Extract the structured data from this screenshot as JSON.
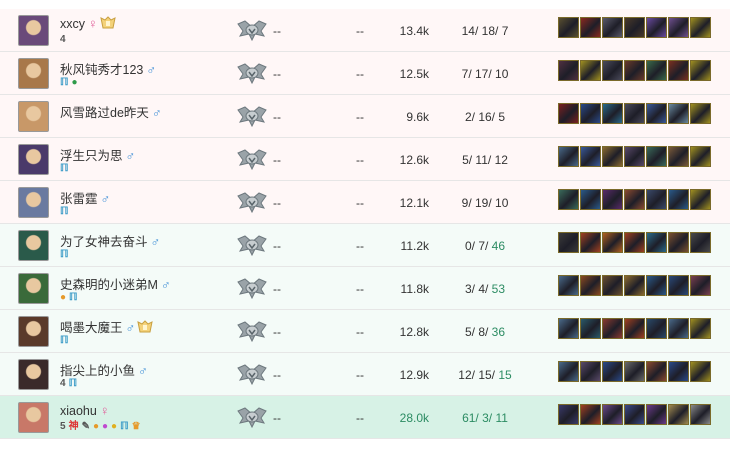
{
  "players": [
    {
      "name": "xxcy",
      "gender": "♀",
      "gender_class": "f",
      "honor": true,
      "tags": [
        {
          "t": "4",
          "c": "dark"
        }
      ],
      "avatar": "#6a4a7a",
      "damage": "13.4k",
      "k": "14",
      "d": "18",
      "a": "7",
      "result": "lose",
      "items": [
        "#5a5030",
        "#8a2a20",
        "#5a5a6a",
        "#4a3a2a",
        "#6a4aa0",
        "#705090",
        "#a09020"
      ]
    },
    {
      "name": "秋风钝秀才123",
      "gender": "♂",
      "gender_class": "m",
      "honor": false,
      "tags": [
        {
          "t": "ℿ",
          "c": "blue"
        },
        {
          "t": "●",
          "c": "green"
        }
      ],
      "avatar": "#a8784a",
      "damage": "12.5k",
      "k": "7",
      "d": "17",
      "a": "10",
      "result": "lose",
      "items": [
        "#503040",
        "#a09020",
        "#4a4a5a",
        "#6a3a2a",
        "#3a6a4a",
        "#7a3020",
        "#a09020"
      ]
    },
    {
      "name": "风雪路过de昨天",
      "gender": "♂",
      "gender_class": "m",
      "honor": false,
      "tags": [],
      "avatar": "#c89868",
      "damage": "9.6k",
      "k": "2",
      "d": "16",
      "a": "5",
      "result": "lose",
      "items": [
        "#7a2020",
        "#2a4a8a",
        "#2a6a8a",
        "#4a4a5a",
        "#3a5a9a",
        "#6a8aa0",
        "#a09020"
      ]
    },
    {
      "name": "浮生只为思",
      "gender": "♂",
      "gender_class": "m",
      "honor": false,
      "tags": [
        {
          "t": "ℿ",
          "c": "blue"
        }
      ],
      "avatar": "#4a3a6a",
      "damage": "12.6k",
      "k": "5",
      "d": "11",
      "a": "12",
      "result": "lose",
      "items": [
        "#4a6a8a",
        "#3a5a9a",
        "#8a6a30",
        "#5a4a6a",
        "#3a6a5a",
        "#7a5a3a",
        "#a09020"
      ]
    },
    {
      "name": "张雷霆",
      "gender": "♂",
      "gender_class": "m",
      "honor": false,
      "tags": [
        {
          "t": "ℿ",
          "c": "blue"
        }
      ],
      "avatar": "#6a7aa0",
      "damage": "12.1k",
      "k": "9",
      "d": "19",
      "a": "10",
      "result": "lose",
      "items": [
        "#3a6a5a",
        "#2a5a8a",
        "#5a2a6a",
        "#8a4a30",
        "#3a4a6a",
        "#2a5a8a",
        "#a09020"
      ]
    },
    {
      "name": "为了女神去奋斗",
      "gender": "♂",
      "gender_class": "m",
      "honor": false,
      "tags": [
        {
          "t": "ℿ",
          "c": "blue"
        }
      ],
      "avatar": "#2a5a4a",
      "damage": "11.2k",
      "k": "0",
      "d": "7",
      "a": "46",
      "result": "win",
      "items": [
        "#3a3a3a",
        "#a04020",
        "#b06020",
        "#a04020",
        "#2a6a8a",
        "#7a5030",
        "#4a4a4a"
      ]
    },
    {
      "name": "史森明的小迷弟M",
      "gender": "♂",
      "gender_class": "m",
      "honor": false,
      "tags": [
        {
          "t": "●",
          "c": "orange"
        },
        {
          "t": "ℿ",
          "c": "blue"
        }
      ],
      "avatar": "#3a6a3a",
      "damage": "11.8k",
      "k": "3",
      "d": "4",
      "a": "53",
      "result": "win",
      "items": [
        "#4a6a8a",
        "#8a4a20",
        "#6a5030",
        "#8a6a30",
        "#2a5a8a",
        "#2a4a7a",
        "#7a4050"
      ]
    },
    {
      "name": "喝墨大魔王",
      "gender": "♂",
      "gender_class": "m",
      "honor": true,
      "tags": [
        {
          "t": "ℿ",
          "c": "blue"
        }
      ],
      "avatar": "#5a3a2a",
      "damage": "12.8k",
      "k": "5",
      "d": "8",
      "a": "36",
      "result": "win",
      "items": [
        "#4a6a8a",
        "#2a5a6a",
        "#8a3a30",
        "#a04020",
        "#2a4a6a",
        "#4a6a8a",
        "#a09020"
      ]
    },
    {
      "name": "指尖上的小鱼",
      "gender": "♂",
      "gender_class": "m",
      "honor": false,
      "tags": [
        {
          "t": "4",
          "c": "dark"
        },
        {
          "t": "ℿ",
          "c": "blue"
        }
      ],
      "avatar": "#3a2a2a",
      "damage": "12.9k",
      "k": "12",
      "d": "15",
      "a": "15",
      "result": "win",
      "items": [
        "#4a6a8a",
        "#5a4a6a",
        "#2a4a8a",
        "#6a6a6a",
        "#8a4a30",
        "#2a4a8a",
        "#a09020"
      ]
    },
    {
      "name": "xiaohu",
      "gender": "♀",
      "gender_class": "f",
      "honor": false,
      "tags": [
        {
          "t": "5",
          "c": "dark"
        },
        {
          "t": "神",
          "c": "red"
        },
        {
          "t": "✎",
          "c": "dark"
        },
        {
          "t": "●",
          "c": "orange"
        },
        {
          "t": "●",
          "c": "purple"
        },
        {
          "t": "●",
          "c": "yellow"
        },
        {
          "t": "ℿ",
          "c": "blue"
        },
        {
          "t": "♛",
          "c": "orange"
        }
      ],
      "avatar": "#c87868",
      "damage": "28.0k",
      "k": "61",
      "d": "3",
      "a": "11",
      "result": "me",
      "items": [
        "#3a3a6a",
        "#a04020",
        "#6a4a8a",
        "#3a4a8a",
        "#6a3a8a",
        "#a08a50",
        "#8a8a8a"
      ]
    }
  ],
  "placeholders": {
    "tier": "--",
    "extra": "--"
  },
  "colors": {
    "lose_bg": "#fff7f7",
    "win_bg": "#f4fbf8",
    "me_bg": "#d7f2e6",
    "win_text": "#2c8c63",
    "male": "#3f8fd6",
    "female": "#e0609a"
  }
}
